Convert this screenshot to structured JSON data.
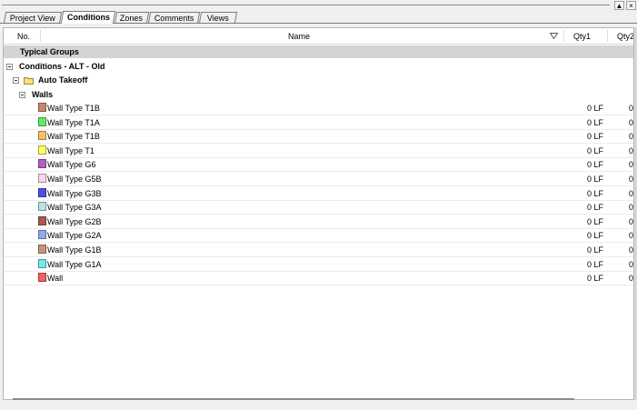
{
  "window": {
    "pin_icon": "pin-icon",
    "close_icon": "close-icon",
    "pin_glyph": "▲",
    "close_glyph": "×"
  },
  "tabs": [
    {
      "label": "Project View",
      "active": false
    },
    {
      "label": "Conditions",
      "active": true
    },
    {
      "label": "Zones",
      "active": false
    },
    {
      "label": "Comments",
      "active": false
    },
    {
      "label": "Views",
      "active": false
    }
  ],
  "columns": {
    "no": "No.",
    "name": "Name",
    "qty1": "Qty1",
    "qty2": "Qty2"
  },
  "group_bar": "Typical Groups",
  "tree": {
    "root": "Conditions - ALT - Old",
    "folder": "Auto Takeoff",
    "category": "Walls"
  },
  "items": [
    {
      "name": "Wall Type T1B",
      "color": "#c8876a",
      "qty1": "0 LF",
      "qty2": "0"
    },
    {
      "name": "Wall Type T1A",
      "color": "#66e866",
      "qty1": "0 LF",
      "qty2": "0"
    },
    {
      "name": "Wall Type T1B",
      "color": "#f5c06a",
      "qty1": "0 LF",
      "qty2": "0"
    },
    {
      "name": "Wall Type T1",
      "color": "#ffff66",
      "qty1": "0 LF",
      "qty2": "0"
    },
    {
      "name": "Wall Type G6",
      "color": "#b060c0",
      "qty1": "0 LF",
      "qty2": "0"
    },
    {
      "name": "Wall Type G5B",
      "color": "#ffd6e8",
      "qty1": "0 LF",
      "qty2": "0"
    },
    {
      "name": "Wall Type G3B",
      "color": "#5050e0",
      "qty1": "0 LF",
      "qty2": "0"
    },
    {
      "name": "Wall Type G3A",
      "color": "#b8e4e0",
      "qty1": "0 LF",
      "qty2": "0"
    },
    {
      "name": "Wall Type G2B",
      "color": "#a85858",
      "qty1": "0 LF",
      "qty2": "0"
    },
    {
      "name": "Wall Type G2A",
      "color": "#90a8ec",
      "qty1": "0 LF",
      "qty2": "0"
    },
    {
      "name": "Wall Type G1B",
      "color": "#c89478",
      "qty1": "0 LF",
      "qty2": "0"
    },
    {
      "name": "Wall Type G1A",
      "color": "#70ecec",
      "qty1": "0 LF",
      "qty2": "0"
    },
    {
      "name": "Wall",
      "color": "#f06060",
      "qty1": "0 LF",
      "qty2": "0"
    }
  ]
}
